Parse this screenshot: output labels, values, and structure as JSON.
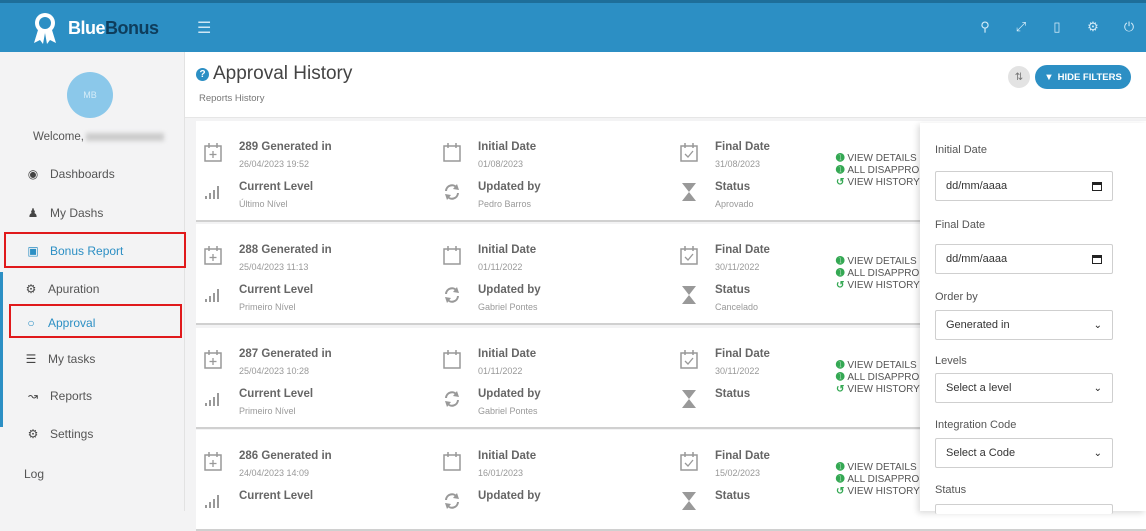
{
  "app": {
    "brand_a": "Blue",
    "brand_b": "Bonus"
  },
  "topbar": {
    "icons": [
      "menu-icon",
      "search-icon",
      "expand-icon",
      "mobile-icon",
      "settings-icon",
      "power-icon"
    ]
  },
  "sidebar": {
    "welcome": "Welcome,",
    "items": [
      {
        "label": "Dashboards",
        "icon": "dashboard-icon"
      },
      {
        "label": "My Dashs",
        "icon": "user-icon"
      },
      {
        "label": "Bonus Report",
        "icon": "money-icon"
      },
      {
        "label": "Apuration",
        "icon": "cogs-icon"
      },
      {
        "label": "Approval",
        "icon": "circle-icon"
      },
      {
        "label": "My tasks",
        "icon": "list-icon"
      },
      {
        "label": "Reports",
        "icon": "chart-icon"
      },
      {
        "label": "Settings",
        "icon": "cogs-icon"
      },
      {
        "label": "Log",
        "icon": ""
      }
    ]
  },
  "header": {
    "title": "Approval History",
    "subtitle": "Reports History",
    "hide_filters": "HIDE FILTERS"
  },
  "labels": {
    "generated_suffix": "Generated in",
    "initial_date": "Initial Date",
    "final_date": "Final Date",
    "current_level": "Current Level",
    "updated_by": "Updated by",
    "status": "Status",
    "view_details": "VIEW DETAILS",
    "all_disapprove": "ALL DISAPPRO",
    "view_history": "VIEW HISTORY"
  },
  "cards": [
    {
      "id": "289 Generated in",
      "generated": "26/04/2023 19:52",
      "initial": "01/08/2023",
      "final": "31/08/2023",
      "level": "Último Nível",
      "updated_by": "Pedro Barros",
      "status": "Aprovado"
    },
    {
      "id": "288 Generated in",
      "generated": "25/04/2023 11:13",
      "initial": "01/11/2022",
      "final": "30/11/2022",
      "level": "Primeiro Nível",
      "updated_by": "Gabriel Pontes",
      "status": "Cancelado"
    },
    {
      "id": "287 Generated in",
      "generated": "25/04/2023 10:28",
      "initial": "01/11/2022",
      "final": "30/11/2022",
      "level": "Primeiro Nível",
      "updated_by": "Gabriel Pontes",
      "status": ""
    },
    {
      "id": "286 Generated in",
      "generated": "24/04/2023 14:09",
      "initial": "16/01/2023",
      "final": "15/02/2023",
      "level": "",
      "updated_by": "",
      "status": ""
    }
  ],
  "filters": {
    "initial_date_label": "Initial Date",
    "initial_date_placeholder": "dd/mm/aaaa",
    "final_date_label": "Final Date",
    "final_date_placeholder": "dd/mm/aaaa",
    "order_by_label": "Order by",
    "order_by_value": "Generated in",
    "levels_label": "Levels",
    "levels_value": "Select a level",
    "integration_label": "Integration Code",
    "integration_value": "Select a Code",
    "status_label": "Status"
  },
  "colors": {
    "primary": "#2c8fc4",
    "highlight": "#e0191b",
    "action_green": "#34a853"
  }
}
